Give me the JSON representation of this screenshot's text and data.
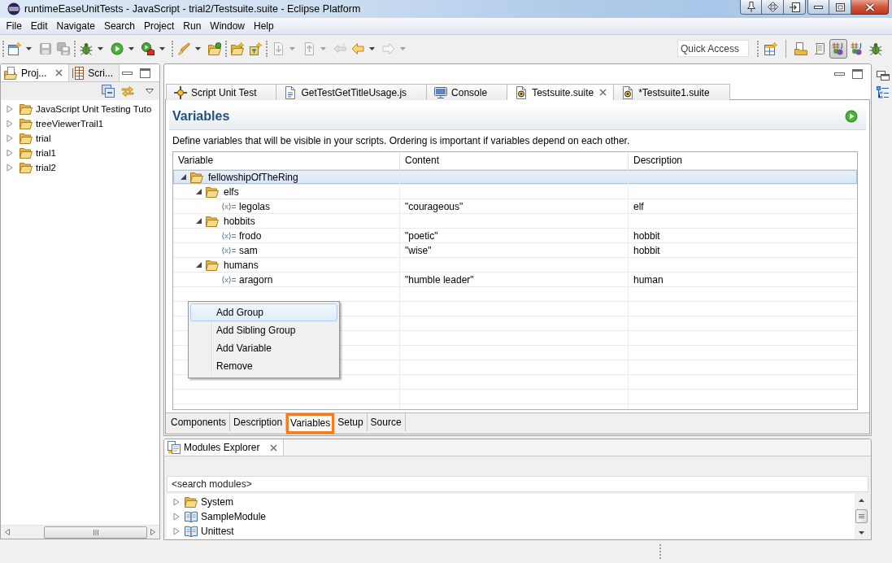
{
  "window": {
    "title": "runtimeEaseUnitTests - JavaScript - trial2/Testsuite.suite - Eclipse Platform"
  },
  "menu_bar": [
    "File",
    "Edit",
    "Navigate",
    "Search",
    "Project",
    "Run",
    "Window",
    "Help"
  ],
  "toolbar": {
    "groups": [
      [
        {
          "dropdown": true,
          "disabled": false
        },
        {
          "dropdown": false,
          "disabled": true
        },
        {
          "dropdown": false,
          "disabled": true
        }
      ],
      [
        {
          "dropdown": true,
          "disabled": false
        },
        {
          "dropdown": true,
          "disabled": false
        },
        {
          "dropdown": true,
          "disabled": false
        }
      ],
      [
        {
          "dropdown": true,
          "disabled": false
        },
        {
          "dropdown": false,
          "disabled": false
        }
      ],
      [
        {
          "dropdown": false,
          "disabled": false
        },
        {
          "dropdown": false,
          "disabled": false
        }
      ],
      [
        {
          "dropdown": true,
          "disabled": true
        },
        {
          "dropdown": true,
          "disabled": true
        },
        {
          "dropdown": false,
          "disabled": true
        },
        {
          "dropdown": true,
          "disabled": false
        },
        {
          "dropdown": true,
          "disabled": true
        }
      ]
    ],
    "quick_access": {
      "placeholder": "Quick Access"
    },
    "perspectives": [
      {
        "selected": false
      },
      {
        "selected": false
      },
      {
        "selected": true
      },
      {
        "selected": false
      },
      {
        "selected": false
      }
    ]
  },
  "project_explorer": {
    "tabs": [
      {
        "label": "Proj...",
        "selected": true
      },
      {
        "label": "Scri...",
        "selected": false
      }
    ],
    "tree": [
      {
        "label": "JavaScript Unit Testing Tuto",
        "expanded": false
      },
      {
        "label": "treeViewerTrail1",
        "expanded": false
      },
      {
        "label": "trial",
        "expanded": false
      },
      {
        "label": "trial1",
        "expanded": false
      },
      {
        "label": "trial2",
        "expanded": false
      }
    ]
  },
  "editor": {
    "tabs": [
      {
        "label": "Script Unit Test",
        "selected": false
      },
      {
        "label": "GetTestGetTitleUsage.js",
        "selected": false
      },
      {
        "label": "Console",
        "selected": false
      },
      {
        "label": "Testsuite.suite",
        "selected": true
      },
      {
        "label": "*Testsuite1.suite",
        "selected": false
      }
    ],
    "heading": "Variables",
    "description": "Define variables that will be visible in your scripts. Ordering is important if variables depend on each other.",
    "table": {
      "columns": [
        "Variable",
        "Content",
        "Description"
      ],
      "rows": [
        {
          "kind": "group",
          "name": "fellowshipOfTheRing",
          "expanded": true,
          "selected": true,
          "children": [
            {
              "kind": "group",
              "name": "elfs",
              "expanded": true,
              "selected": false,
              "children": [
                {
                  "kind": "variable",
                  "name": "legolas",
                  "content": "\"courageous\"",
                  "description": "elf",
                  "selected": false
                }
              ]
            },
            {
              "kind": "group",
              "name": "hobbits",
              "expanded": true,
              "selected": false,
              "children": [
                {
                  "kind": "variable",
                  "name": "frodo",
                  "content": "\"poetic\"",
                  "description": "hobbit",
                  "selected": false
                },
                {
                  "kind": "variable",
                  "name": "sam",
                  "content": "\"wise\"",
                  "description": "hobbit",
                  "selected": false
                }
              ]
            },
            {
              "kind": "group",
              "name": "humans",
              "expanded": true,
              "selected": false,
              "children": [
                {
                  "kind": "variable",
                  "name": "aragorn",
                  "content": "\"humble leader\"",
                  "description": "human",
                  "selected": false
                }
              ]
            }
          ]
        }
      ]
    },
    "context_menu": [
      {
        "label": "Add Group",
        "selected": true
      },
      {
        "label": "Add Sibling Group",
        "selected": false
      },
      {
        "label": "Add Variable",
        "selected": false
      },
      {
        "label": "Remove",
        "selected": false
      }
    ],
    "page_tabs": [
      {
        "label": "Components",
        "selected": false
      },
      {
        "label": "Description",
        "selected": false
      },
      {
        "label": "Variables",
        "selected": true
      },
      {
        "label": "Setup",
        "selected": false
      },
      {
        "label": "Source",
        "selected": false
      }
    ]
  },
  "modules_explorer": {
    "title": "Modules Explorer",
    "search": {
      "placeholder": "<search modules>"
    },
    "tree": [
      {
        "label": "System",
        "kind": "folder",
        "expanded": false
      },
      {
        "label": "SampleModule",
        "kind": "module",
        "expanded": false
      },
      {
        "label": "Unittest",
        "kind": "module",
        "expanded": false
      }
    ]
  }
}
